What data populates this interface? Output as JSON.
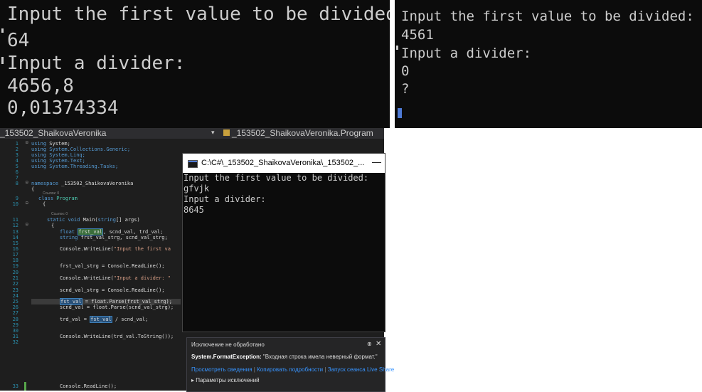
{
  "console1": {
    "lines": [
      "Input the first value to be divided:",
      "64",
      "Input a divider:",
      "4656,8",
      "0,01374334"
    ]
  },
  "console2": {
    "lines": [
      "Input the first value to be divided:",
      "4561",
      "Input a divider:",
      "0",
      "?"
    ]
  },
  "ide": {
    "project": "_153502_ShaikovaVeronika",
    "class_path": "_153502_ShaikovaVeronika.Program",
    "refs0": "Ссылок: 0",
    "line_numbers": [
      "1",
      "2",
      "3",
      "4",
      "5",
      "6",
      "7",
      "8",
      "9",
      "10",
      "11",
      "12",
      "13",
      "14",
      "15",
      "16",
      "17",
      "18",
      "19",
      "20",
      "21",
      "22",
      "23",
      "24",
      "25",
      "26",
      "27",
      "28",
      "29",
      "30",
      "31",
      "32",
      "33"
    ],
    "code": {
      "l1_kw": "using",
      "l1_rest": " System;",
      "l2": "using System.Collections.Generic;",
      "l3": "using System.Linq;",
      "l4": "using System.Text;",
      "l5": "using System.Threading.Tasks;",
      "l7_kw": "namespace",
      "l7_rest": " _153502_ShaikovaVeronika",
      "l8": "{",
      "l9_kw": "class",
      "l9_ty": " Program",
      "l10": "{",
      "l11_kw": "static void",
      "l11_name": " Main(",
      "l11_kw2": "string",
      "l11_rest": "[] args)",
      "l12": "{",
      "l13_kw": "float",
      "l13_hl": "frst_val",
      "l13_rest": ", scnd_val, trd_val;",
      "l14_kw": "string",
      "l14_rest": " frst_val_strg, scnd_val_strg;",
      "l16_a": "Console.",
      "l16_b": "WriteLine(",
      "l16_s": "\"Input the first va",
      "l19": "frst_val_strg = Console.ReadLine();",
      "l21_a": "Console.WriteLine(",
      "l21_s": "\"Input a divider: \"",
      "l23": "scnd_val_strg = Console.ReadLine();",
      "l25_hl": "fst_val",
      "l25_rest": " = float.Parse(frst_val_strg);",
      "l26": "scnd_val = float.Parse(scnd_val_strg);",
      "l28_a": "trd_val = ",
      "l28_hl": "fst_val",
      "l28_rest": " / scnd_val;",
      "l31": "Console.WriteLine(trd_val.ToString());",
      "l33": "Console.ReadLine();"
    }
  },
  "console_window": {
    "title": "C:\\C#\\_153502_ShaikovaVeronika\\_153502_...",
    "minimize": "—",
    "lines": [
      "Input the first value to be divided:",
      "gfvjk",
      "Input a divider:",
      "8645"
    ]
  },
  "exception": {
    "title": "Исключение не обработано",
    "pin": "⊕",
    "close": "✕",
    "type": "System.FormatException:",
    "message": " \"Входная строка имела неверный формат.\"",
    "link1": "Просмотреть сведения",
    "link2": "Копировать подробности",
    "link3": "Запуск сеанса Live Share",
    "params": "▸ Параметры исключений"
  },
  "colors": {
    "console_bg": "#0c0c0c",
    "ide_bg": "#1e1e1e",
    "keyword": "#569cd6",
    "type": "#4ec9b0",
    "link": "#3794ff"
  }
}
